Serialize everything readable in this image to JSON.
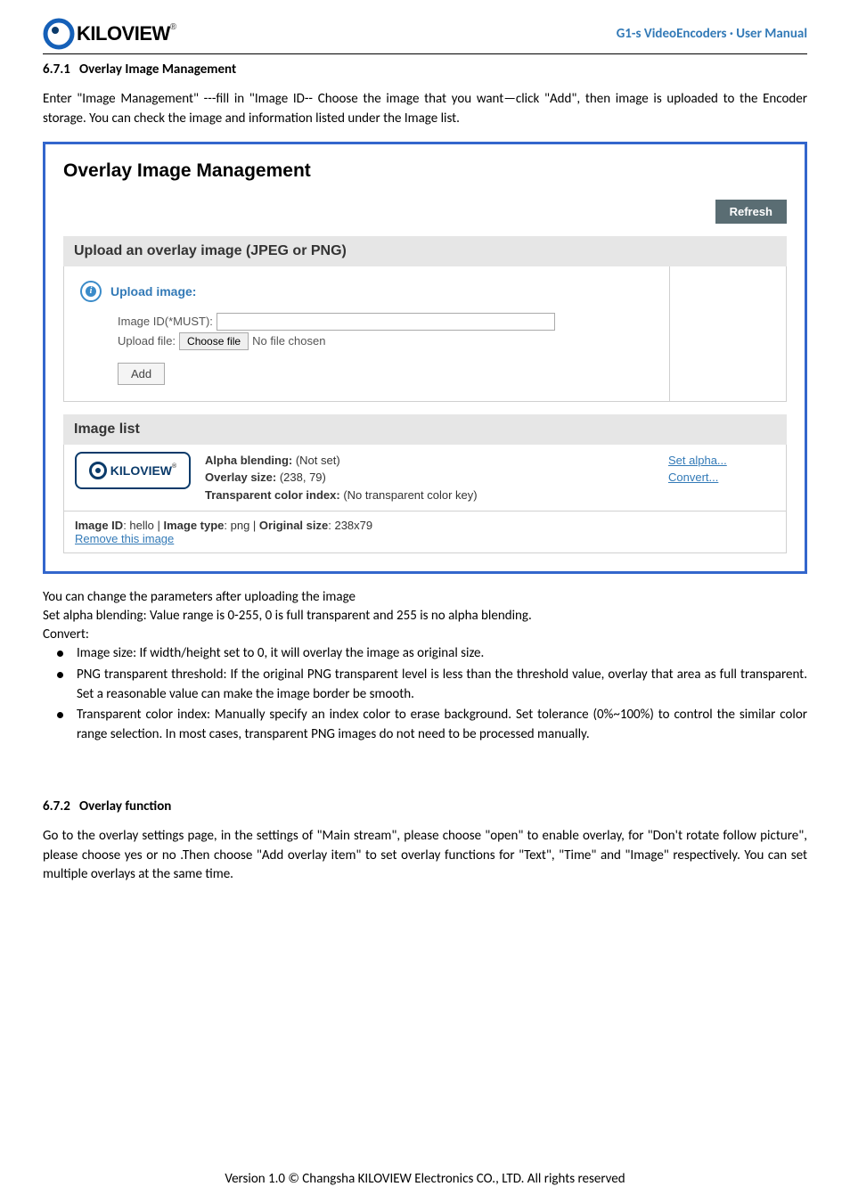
{
  "header": {
    "logo_text": "KILOVIEW",
    "right": "G1-s VideoEncoders · User Manual"
  },
  "section1": {
    "num": "6.7.1",
    "title": "Overlay Image Management",
    "para": "Enter \"Image Management\" ---fill in \"Image ID-- Choose the image that you want—click \"Add\", then image is uploaded to the Encoder storage. You can check the image and information listed under the Image list."
  },
  "screenshot": {
    "title": "Overlay Image Management",
    "refresh": "Refresh",
    "upload_header": "Upload an overlay image (JPEG or PNG)",
    "upload_title": "Upload image:",
    "image_id_label": "Image ID(*MUST):",
    "image_id_value": "",
    "upload_file_label": "Upload file:",
    "choose_file": "Choose file",
    "no_file": "No file chosen",
    "add": "Add",
    "list_header": "Image list",
    "thumb_text": "KILOVIEW",
    "info_alpha_label": "Alpha blending:",
    "info_alpha_value": " (Not set)",
    "info_size_label": "Overlay size:",
    "info_size_value": " (238, 79)",
    "info_trans_label": "Transparent color index:",
    "info_trans_value": " (No transparent color key)",
    "action_set_alpha": "Set alpha...",
    "action_convert": "Convert...",
    "meta_id_label": "Image ID",
    "meta_id_value": ": hello | ",
    "meta_type_label": "Image type",
    "meta_type_value": ": png | ",
    "meta_osize_label": "Original size",
    "meta_osize_value": ": 238x79",
    "remove": "Remove this image"
  },
  "post": {
    "line1": "You can change the parameters after uploading the image",
    "line2": "Set alpha blending: Value range is 0-255, 0 is full transparent and 255 is no alpha blending.",
    "line3": "Convert:",
    "bullet1": "Image size: If width/height set to 0, it will overlay the image as original size.",
    "bullet2": "PNG transparent threshold: If the original PNG transparent level is less than the threshold value, overlay that area as full transparent. Set a reasonable value can make the image border be smooth.",
    "bullet3": "Transparent color index: Manually specify an index color to erase background. Set tolerance (0%~100%) to control the similar color range selection. In most cases, transparent PNG images do not need to be processed manually."
  },
  "section2": {
    "num": "6.7.2",
    "title": "Overlay function",
    "para": "Go to the overlay settings page, in the settings of \"Main stream\", please choose \"open\" to enable overlay, for \"Don't rotate follow picture\", please choose yes or no .Then choose \"Add overlay item\" to set overlay functions for \"Text\", \"Time\" and \"Image\" respectively. You can set multiple overlays at the same time."
  },
  "footer": "Version 1.0 © Changsha KILOVIEW Electronics CO., LTD. All rights reserved"
}
